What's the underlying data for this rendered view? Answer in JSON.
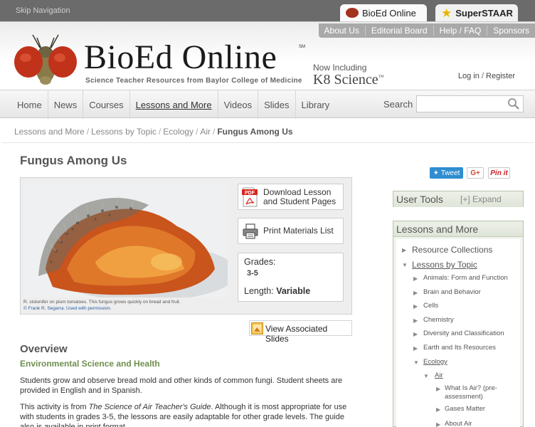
{
  "topbar": {
    "skip": "Skip Navigation",
    "tabs": [
      {
        "label": "BioEd Online"
      },
      {
        "label": "SuperSTAAR"
      }
    ]
  },
  "header": {
    "utility": [
      "About Us",
      "Editorial Board",
      "Help / FAQ",
      "Sponsors"
    ],
    "logo_title": "BioEd Online",
    "logo_sm": "SM",
    "tagline": "Science Teacher Resources from Baylor College of Medicine",
    "now_including": "Now Including",
    "k8": "K8 Science",
    "k8_tm": "™",
    "login": "Log in",
    "login_sep": "/",
    "register": "Register"
  },
  "nav": {
    "items": [
      "Home",
      "News",
      "Courses",
      "Lessons and More",
      "Videos",
      "Slides",
      "Library"
    ],
    "search_label": "Search",
    "search_value": ""
  },
  "breadcrumb": {
    "items": [
      "Lessons and More",
      "Lessons by Topic",
      "Ecology",
      "Air"
    ],
    "current": "Fungus Among Us",
    "sep": "/"
  },
  "title": "Fungus Among Us",
  "share": {
    "tweet": "Tweet",
    "gplus": "G+",
    "pinit": "Pin it"
  },
  "lesson": {
    "caption_line1": "R. stolonifer on plum tomatoes. This fungus grows quickly on bread and fruit.",
    "caption_line2": "© Frank R. Segarra. Used with permission.",
    "pdf_tag": "PDF",
    "download_label_1": "Download Lesson",
    "download_label_2": "and Student Pages",
    "print_label": "Print Materials List",
    "grades_label": "Grades:",
    "grades_value": "3-5",
    "length_label": "Length:",
    "length_value": "Variable",
    "slides_label": "View Associated Slides"
  },
  "overview": {
    "heading": "Overview",
    "subject": "Environmental Science and Health",
    "para1": "Students grow and observe bread mold and other kinds of common fungi. Student sheets are provided in English and in Spanish.",
    "para2_pre": "This activity is from ",
    "para2_italic": "The Science of Air Teacher's Guide",
    "para2_post": ". Although it is most appropriate for use with students in grades 3-5, the lessons are easily adaptable for other grade levels. The guide also is available in print format."
  },
  "sidebar": {
    "user_tools": "User Tools",
    "expand": "[+] Expand",
    "lam_heading": "Lessons and More",
    "tree": [
      {
        "label": "Resource Collections",
        "level": 1,
        "open": false
      },
      {
        "label": "Lessons by Topic",
        "level": 1,
        "open": true
      },
      {
        "label": "Animals: Form and Function",
        "level": 2,
        "open": false
      },
      {
        "label": "Brain and Behavior",
        "level": 2,
        "open": false
      },
      {
        "label": "Cells",
        "level": 2,
        "open": false
      },
      {
        "label": "Chemistry",
        "level": 2,
        "open": false
      },
      {
        "label": "Diversity and Classification",
        "level": 2,
        "open": false
      },
      {
        "label": "Earth and Its Resources",
        "level": 2,
        "open": false
      },
      {
        "label": "Ecology",
        "level": 2,
        "open": true
      },
      {
        "label": "Air",
        "level": 3,
        "open": true
      },
      {
        "label": "What Is Air? (pre-",
        "label2": "assessment)",
        "level": 4,
        "open": false
      },
      {
        "label": "Gases Matter",
        "level": 4,
        "open": false
      },
      {
        "label": "About Air",
        "level": 4,
        "open": false
      }
    ]
  },
  "colors": {
    "accent_green": "#6f8f4f",
    "tweet_blue": "#2f8dd0",
    "star_gold": "#e7b400",
    "link_blue": "#2a5d9f"
  }
}
